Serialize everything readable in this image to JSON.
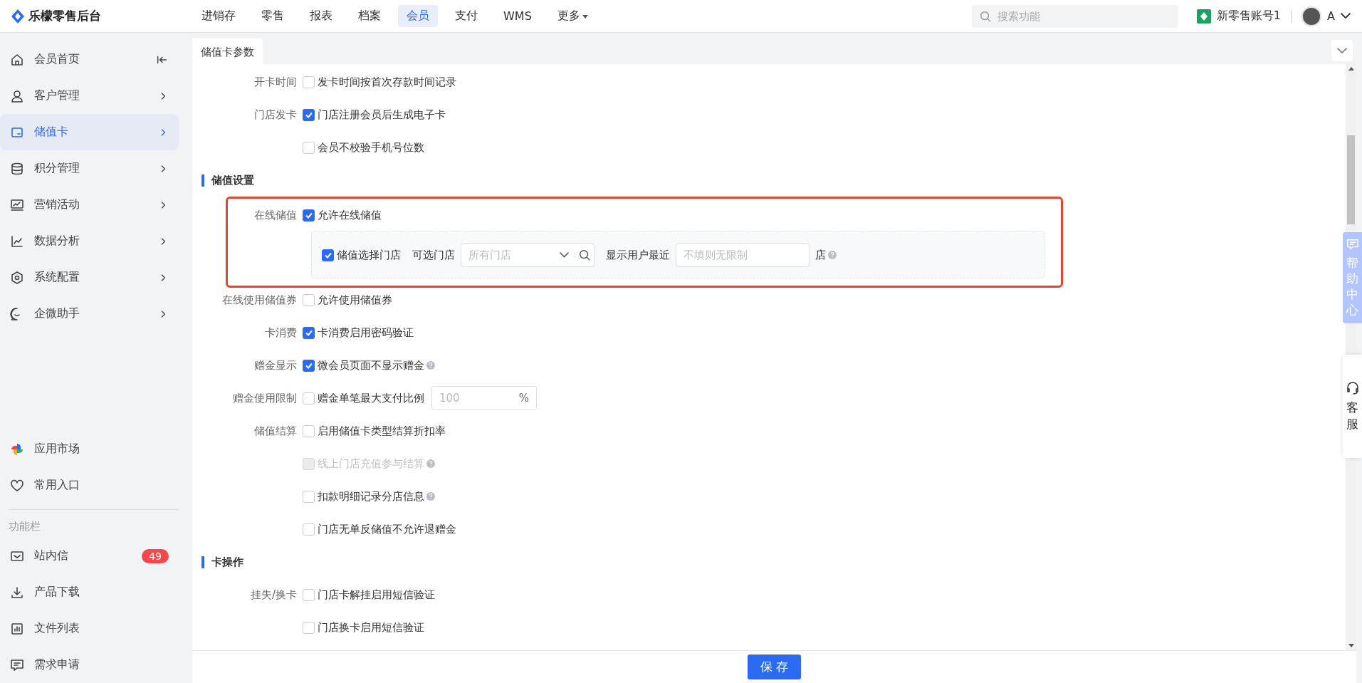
{
  "app": {
    "logo": "乐檬零售后台"
  },
  "nav": [
    {
      "label": "进销存",
      "selected": false,
      "dropdown": false
    },
    {
      "label": "零售",
      "selected": false,
      "dropdown": false
    },
    {
      "label": "报表",
      "selected": false,
      "dropdown": false
    },
    {
      "label": "档案",
      "selected": false,
      "dropdown": false
    },
    {
      "label": "会员",
      "selected": true,
      "dropdown": false
    },
    {
      "label": "支付",
      "selected": false,
      "dropdown": false
    },
    {
      "label": "WMS",
      "selected": false,
      "dropdown": false
    },
    {
      "label": "更多",
      "selected": false,
      "dropdown": true
    }
  ],
  "search": {
    "placeholder": "搜索功能"
  },
  "account": {
    "name": "新零售账号1",
    "user": "A"
  },
  "sidebar": {
    "items": [
      {
        "label": "会员首页",
        "selected": false
      },
      {
        "label": "客户管理",
        "selected": false
      },
      {
        "label": "储值卡",
        "selected": true
      },
      {
        "label": "积分管理",
        "selected": false
      },
      {
        "label": "营销活动",
        "selected": false
      },
      {
        "label": "数据分析",
        "selected": false
      },
      {
        "label": "系统配置",
        "selected": false
      },
      {
        "label": "企微助手",
        "selected": false
      }
    ],
    "bottom": [
      {
        "label": "应用市场"
      },
      {
        "label": "常用入口"
      }
    ],
    "section": "功能栏",
    "tools": [
      {
        "label": "站内信",
        "badge": "49"
      },
      {
        "label": "产品下载"
      },
      {
        "label": "文件列表"
      },
      {
        "label": "需求申请"
      }
    ]
  },
  "tabs": [
    {
      "label": "储值卡参数",
      "selected": true
    }
  ],
  "form": [
    {
      "kind": "check",
      "label": "开卡时间",
      "text": "发卡时间按首次存款时间记录",
      "checked": false,
      "disabled": false,
      "help": false
    },
    {
      "kind": "check",
      "label": "门店发卡",
      "text": "门店注册会员后生成电子卡",
      "checked": true,
      "disabled": false,
      "help": false
    },
    {
      "kind": "check",
      "text": "会员不校验手机号位数",
      "checked": false,
      "disabled": false,
      "help": false
    },
    {
      "kind": "section",
      "title": "储值设置"
    },
    {
      "kind": "highlight",
      "items": [
        {
          "kind": "check",
          "label": "在线储值",
          "text": "允许在线储值",
          "checked": true,
          "disabled": false,
          "help": false
        },
        {
          "kind": "store",
          "text": "储值选择门店",
          "checked": true,
          "store_label": "可选门店",
          "store_placeholder": "所有门店",
          "recent_label": "显示用户最近",
          "recent_placeholder": "不填则无限制",
          "unit": "店"
        }
      ]
    },
    {
      "kind": "check",
      "label": "在线使用储值券",
      "text": "允许使用储值券",
      "checked": false,
      "disabled": false,
      "help": false
    },
    {
      "kind": "check",
      "label": "卡消费",
      "text": "卡消费启用密码验证",
      "checked": true,
      "disabled": false,
      "help": false
    },
    {
      "kind": "check",
      "label": "赠金显示",
      "text": "微会员页面不显示赠金",
      "checked": true,
      "disabled": false,
      "help": true
    },
    {
      "kind": "ratio",
      "label": "赠金使用限制",
      "text": "赠金单笔最大支付比例",
      "checked": false,
      "placeholder": "100",
      "unit": "%"
    },
    {
      "kind": "check",
      "label": "储值结算",
      "text": "启用储值卡类型结算折扣率",
      "checked": false,
      "disabled": false,
      "help": false
    },
    {
      "kind": "check",
      "text": "线上门店充值参与结算",
      "checked": false,
      "disabled": true,
      "help": true
    },
    {
      "kind": "check",
      "text": "扣款明细记录分店信息",
      "checked": false,
      "disabled": false,
      "help": true
    },
    {
      "kind": "check",
      "text": "门店无单反储值不允许退赠金",
      "checked": false,
      "disabled": false,
      "help": false
    },
    {
      "kind": "section",
      "title": "卡操作"
    },
    {
      "kind": "check",
      "label": "挂失/换卡",
      "text": "门店卡解挂启用短信验证",
      "checked": false,
      "disabled": false,
      "help": false
    },
    {
      "kind": "check",
      "text": "门店换卡启用短信验证",
      "checked": false,
      "disabled": false,
      "help": false
    }
  ],
  "save": "保 存",
  "help": {
    "label": "帮助中心"
  },
  "service": {
    "label": "客服"
  }
}
